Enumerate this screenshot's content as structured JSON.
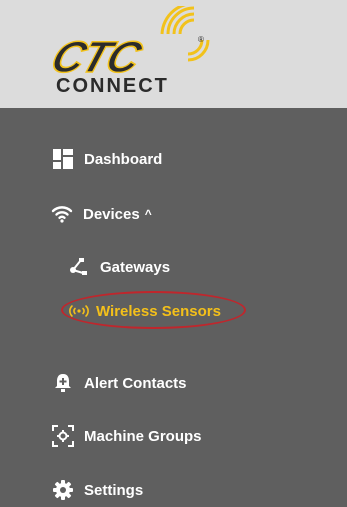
{
  "logo": {
    "top_text": "CTC",
    "bottom_text": "CONNECT",
    "registered_mark": "®"
  },
  "nav": {
    "dashboard": "Dashboard",
    "devices": "Devices",
    "devices_caret": "^",
    "gateways": "Gateways",
    "wireless_sensors": "Wireless Sensors",
    "alert_contacts": "Alert Contacts",
    "machine_groups": "Machine Groups",
    "settings": "Settings"
  },
  "colors": {
    "header_bg": "#dcdcdc",
    "sidebar_bg": "#5f5f5f",
    "active_item": "#f4c01a",
    "highlight_ring": "#c0262c",
    "logo_gold": "#f2c21b",
    "logo_dark": "#2b2b2b"
  },
  "icons": {
    "dashboard": "dashboard-grid-icon",
    "devices": "wifi-icon",
    "gateways": "gateway-network-icon",
    "wireless_sensors": "wireless-broadcast-icon",
    "alert_contacts": "alert-bell-icon",
    "machine_groups": "machine-groups-icon",
    "settings": "gear-icon"
  }
}
